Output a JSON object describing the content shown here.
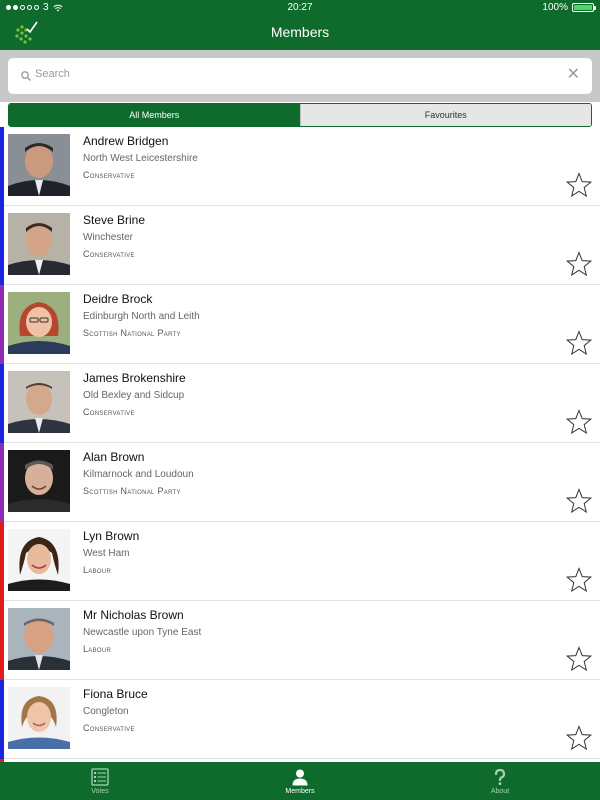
{
  "status": {
    "carrier": "3",
    "time": "20:27",
    "battery": "100%"
  },
  "nav": {
    "title": "Members"
  },
  "search": {
    "placeholder": "Search"
  },
  "segments": {
    "all": "All Members",
    "favourites": "Favourites"
  },
  "colors": {
    "brand": "#0f6b2c",
    "conservative": "#1b25e0",
    "snp": "#8f2bb4",
    "labour": "#e11b1b"
  },
  "members": [
    {
      "name": "Andrew Bridgen",
      "seat": "North West Leicestershire",
      "party": "Conservative",
      "party_color": "#1b25e0"
    },
    {
      "name": "Steve Brine",
      "seat": "Winchester",
      "party": "Conservative",
      "party_color": "#1b25e0"
    },
    {
      "name": "Deidre Brock",
      "seat": "Edinburgh North and Leith",
      "party": "Scottish National Party",
      "party_color": "#8f2bb4"
    },
    {
      "name": "James Brokenshire",
      "seat": "Old Bexley and Sidcup",
      "party": "Conservative",
      "party_color": "#1b25e0"
    },
    {
      "name": "Alan Brown",
      "seat": "Kilmarnock and Loudoun",
      "party": "Scottish National Party",
      "party_color": "#8f2bb4"
    },
    {
      "name": "Lyn Brown",
      "seat": "West Ham",
      "party": "Labour",
      "party_color": "#e11b1b"
    },
    {
      "name": "Mr Nicholas Brown",
      "seat": "Newcastle upon Tyne East",
      "party": "Labour",
      "party_color": "#e11b1b"
    },
    {
      "name": "Fiona Bruce",
      "seat": "Congleton",
      "party": "Conservative",
      "party_color": "#1b25e0"
    }
  ],
  "tabs": [
    {
      "label": "Votes",
      "icon": "list-icon"
    },
    {
      "label": "Members",
      "icon": "person-icon"
    },
    {
      "label": "About",
      "icon": "question-icon"
    }
  ]
}
